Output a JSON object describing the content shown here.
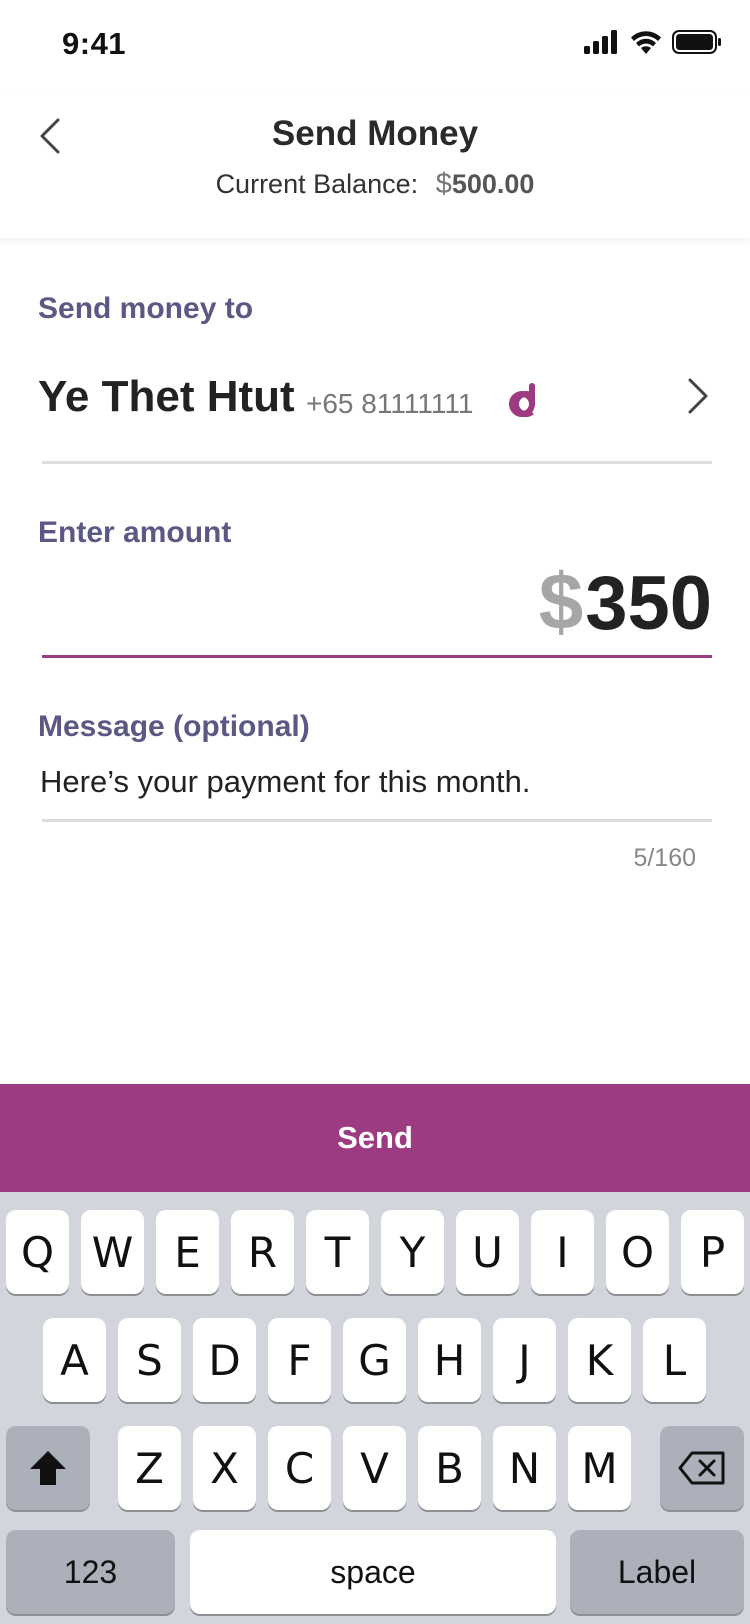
{
  "status_bar": {
    "time": "9:41"
  },
  "header": {
    "title": "Send Money",
    "balance_label": "Current Balance:",
    "balance_currency": "$",
    "balance_value": "500.00"
  },
  "recipient": {
    "label": "Send money to",
    "name": "Ye Thet Htut",
    "phone": "+65 81111111"
  },
  "amount": {
    "label": "Enter amount",
    "currency": "$",
    "value": "350"
  },
  "message": {
    "label": "Message (optional)",
    "value": "Here’s your payment for this month.",
    "char_count": "5/160"
  },
  "send_button": {
    "label": "Send"
  },
  "keyboard": {
    "row1": [
      "Q",
      "W",
      "E",
      "R",
      "T",
      "Y",
      "U",
      "I",
      "O",
      "P"
    ],
    "row2": [
      "A",
      "S",
      "D",
      "F",
      "G",
      "H",
      "J",
      "K",
      "L"
    ],
    "row3": [
      "Z",
      "X",
      "C",
      "V",
      "B",
      "N",
      "M"
    ],
    "numbers_key": "123",
    "space_key": "space",
    "return_key": "Label"
  },
  "colors": {
    "accent": "#9c3a82",
    "label": "#5c5886",
    "keyboard_bg": "#d2d5db"
  }
}
